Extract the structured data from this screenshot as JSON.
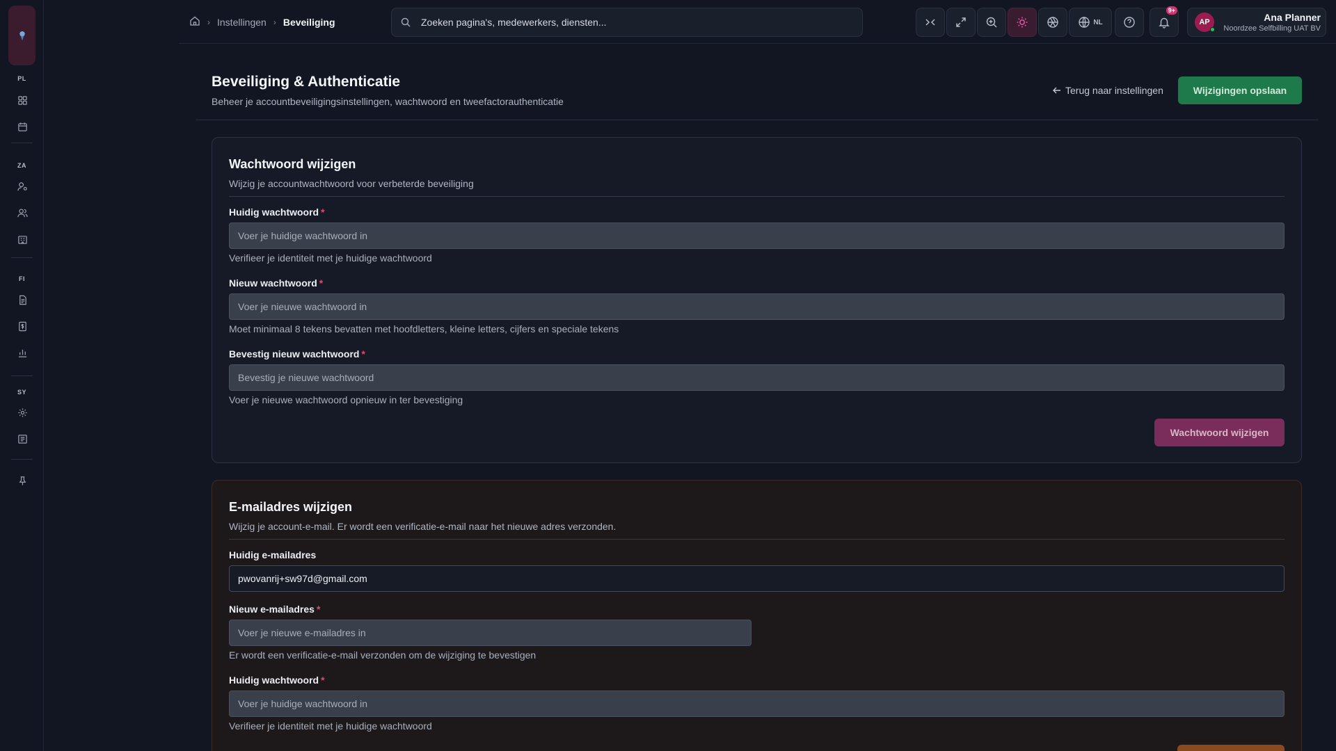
{
  "sidebar": {
    "sections": [
      {
        "label": "PL",
        "items": [
          "dashboard-icon",
          "calendar-icon"
        ]
      },
      {
        "label": "ZA",
        "items": [
          "user-settings-icon",
          "users-icon",
          "building-icon"
        ]
      },
      {
        "label": "FI",
        "items": [
          "document-icon",
          "invoice-icon",
          "chart-icon"
        ]
      },
      {
        "label": "SY",
        "items": [
          "gear-icon",
          "log-icon"
        ]
      }
    ]
  },
  "breadcrumb": {
    "items": [
      "Instellingen"
    ],
    "current": "Beveiliging"
  },
  "search": {
    "placeholder": "Zoeken pagina's, medewerkers, diensten..."
  },
  "toolbar": {
    "language": "NL",
    "notification_badge": "9+"
  },
  "user": {
    "initials": "AP",
    "name": "Ana Planner",
    "org": "Noordzee Selfbilling UAT BV"
  },
  "page": {
    "title": "Beveiliging & Authenticatie",
    "subtitle": "Beheer je accountbeveiligingsinstellingen, wachtwoord en tweefactorauthenticatie",
    "back_label": "Terug naar instellingen",
    "save_label": "Wijzigingen opslaan"
  },
  "password_card": {
    "title": "Wachtwoord wijzigen",
    "subtitle": "Wijzig je accountwachtwoord voor verbeterde beveiliging",
    "current_label": "Huidig wachtwoord",
    "current_placeholder": "Voer je huidige wachtwoord in",
    "current_hint": "Verifieer je identiteit met je huidige wachtwoord",
    "new_label": "Nieuw wachtwoord",
    "new_placeholder": "Voer je nieuwe wachtwoord in",
    "new_hint": "Moet minimaal 8 tekens bevatten met hoofdletters, kleine letters, cijfers en speciale tekens",
    "confirm_label": "Bevestig nieuw wachtwoord",
    "confirm_placeholder": "Bevestig je nieuwe wachtwoord",
    "confirm_hint": "Voer je nieuwe wachtwoord opnieuw in ter bevestiging",
    "button_label": "Wachtwoord wijzigen",
    "required_mark": "*"
  },
  "email_card": {
    "title": "E-mailadres wijzigen",
    "subtitle": "Wijzig je account-e-mail. Er wordt een verificatie-e-mail naar het nieuwe adres verzonden.",
    "current_label": "Huidig e-mailadres",
    "current_value": "pwovanrij+sw97d@gmail.com",
    "new_label": "Nieuw e-mailadres",
    "new_placeholder": "Voer je nieuwe e-mailadres in",
    "new_hint": "Er wordt een verificatie-e-mail verzonden om de wijziging te bevestigen",
    "password_label": "Huidig wachtwoord",
    "password_placeholder": "Voer je huidige wachtwoord in",
    "password_hint": "Verifieer je identiteit met je huidige wachtwoord",
    "required_mark": "*"
  },
  "colors": {
    "accent": "#e0569e",
    "success": "#1f7a4b",
    "warning": "#8b4a1c"
  }
}
